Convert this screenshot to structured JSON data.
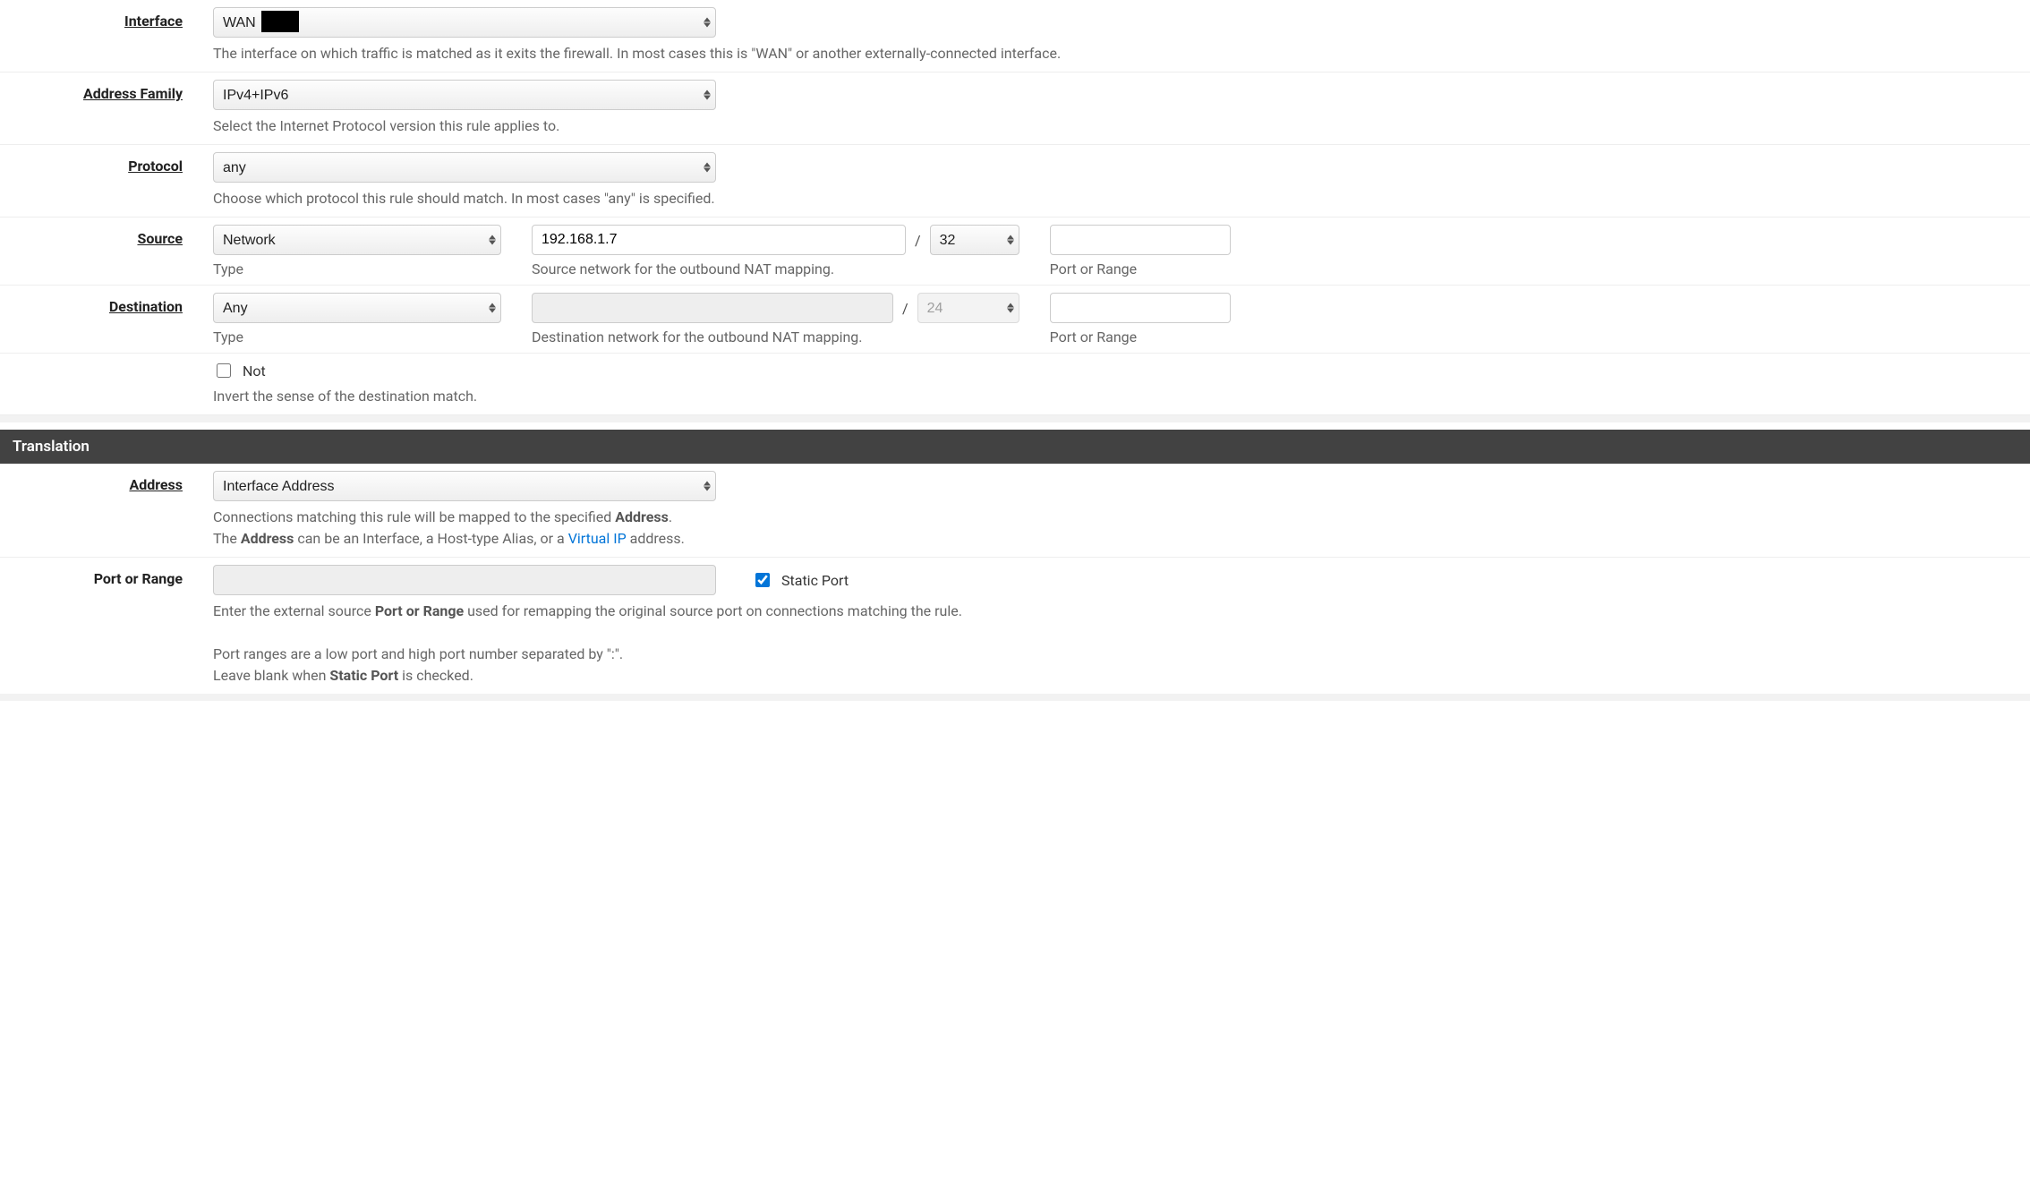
{
  "interface": {
    "label": "Interface",
    "value": "WAN",
    "help": "The interface on which traffic is matched as it exits the firewall. In most cases this is \"WAN\" or another externally-connected interface."
  },
  "address_family": {
    "label": "Address Family",
    "value": "IPv4+IPv6",
    "help": "Select the Internet Protocol version this rule applies to."
  },
  "protocol": {
    "label": "Protocol",
    "value": "any",
    "help": "Choose which protocol this rule should match. In most cases \"any\" is specified."
  },
  "source": {
    "label": "Source",
    "type_value": "Network",
    "type_label": "Type",
    "network_value": "192.168.1.7",
    "network_help": "Source network for the outbound NAT mapping.",
    "mask_value": "32",
    "slash": "/",
    "port_label": "Port or Range",
    "port_value": ""
  },
  "destination": {
    "label": "Destination",
    "type_value": "Any",
    "type_label": "Type",
    "network_value": "",
    "network_help": "Destination network for the outbound NAT mapping.",
    "mask_value": "24",
    "slash": "/",
    "port_label": "Port or Range",
    "port_value": ""
  },
  "not": {
    "checkbox_label": "Not",
    "checked": false,
    "help": "Invert the sense of the destination match."
  },
  "translation_section": "Translation",
  "tr_address": {
    "label": "Address",
    "value": "Interface Address",
    "help_1a": "Connections matching this rule will be mapped to the specified ",
    "help_1b": "Address",
    "help_1c": ".",
    "help_2a": "The ",
    "help_2b": "Address",
    "help_2c": " can be an Interface, a Host-type Alias, or a ",
    "help_2_link": "Virtual IP",
    "help_2d": " address."
  },
  "tr_port": {
    "label": "Port or Range",
    "value": "",
    "static_label": "Static Port",
    "static_checked": true,
    "help_1a": "Enter the external source ",
    "help_1b": "Port or Range",
    "help_1c": " used for remapping the original source port on connections matching the rule.",
    "help_2": "Port ranges are a low port and high port number separated by \":\".",
    "help_3a": "Leave blank when ",
    "help_3b": "Static Port",
    "help_3c": " is checked."
  }
}
